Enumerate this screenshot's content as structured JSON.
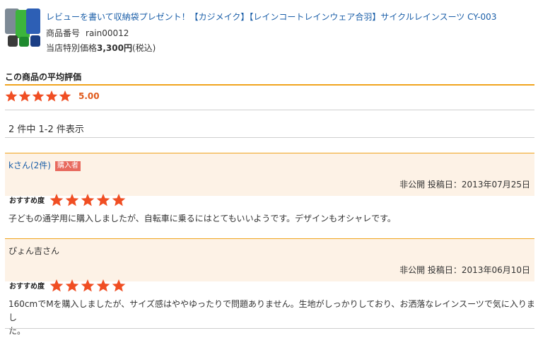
{
  "product": {
    "thumbnail_icon": "rainwear-product-thumbnail",
    "title": "レビューを書いて収納袋プレゼント！【カジメイク】【レインコートレインウェア合羽】サイクルレインスーツ CY-003",
    "code_label": "商品番号",
    "code": "rain00012",
    "price_label": "当店特別価格",
    "price": "3,300円",
    "price_suffix": "(税込)"
  },
  "average": {
    "heading": "この商品の平均評価",
    "stars": 5,
    "value": "5.00"
  },
  "count_text": "2 件中 1-2 件表示",
  "reviews": [
    {
      "reviewer": "kさん(2件)",
      "badge": "購入者",
      "meta": "非公開 投稿日：2013年07月25日",
      "rec_label": "おすすめ度",
      "stars": 5,
      "comment": "子どもの通学用に購入しましたが、自転車に乗るにはとてもいいようです。デザインもオシャレです。"
    },
    {
      "reviewer": "ぴょん吉さん",
      "meta": "非公開 投稿日：2013年06月10日",
      "rec_label": "おすすめ度",
      "stars": 5,
      "comment_line1": "160cmでMを購入しましたが、サイズ感はややゆったりで問題ありません。生地がしっかりしており、お洒落なレインスーツで気に入りまし",
      "comment_line2": "た。"
    }
  ],
  "colors": {
    "accent_orange": "#f0a41e",
    "star_red": "#f04e23",
    "link_blue": "#1a5ea8",
    "review_bg": "#fdf2e6",
    "badge_red": "#e86a5e"
  }
}
